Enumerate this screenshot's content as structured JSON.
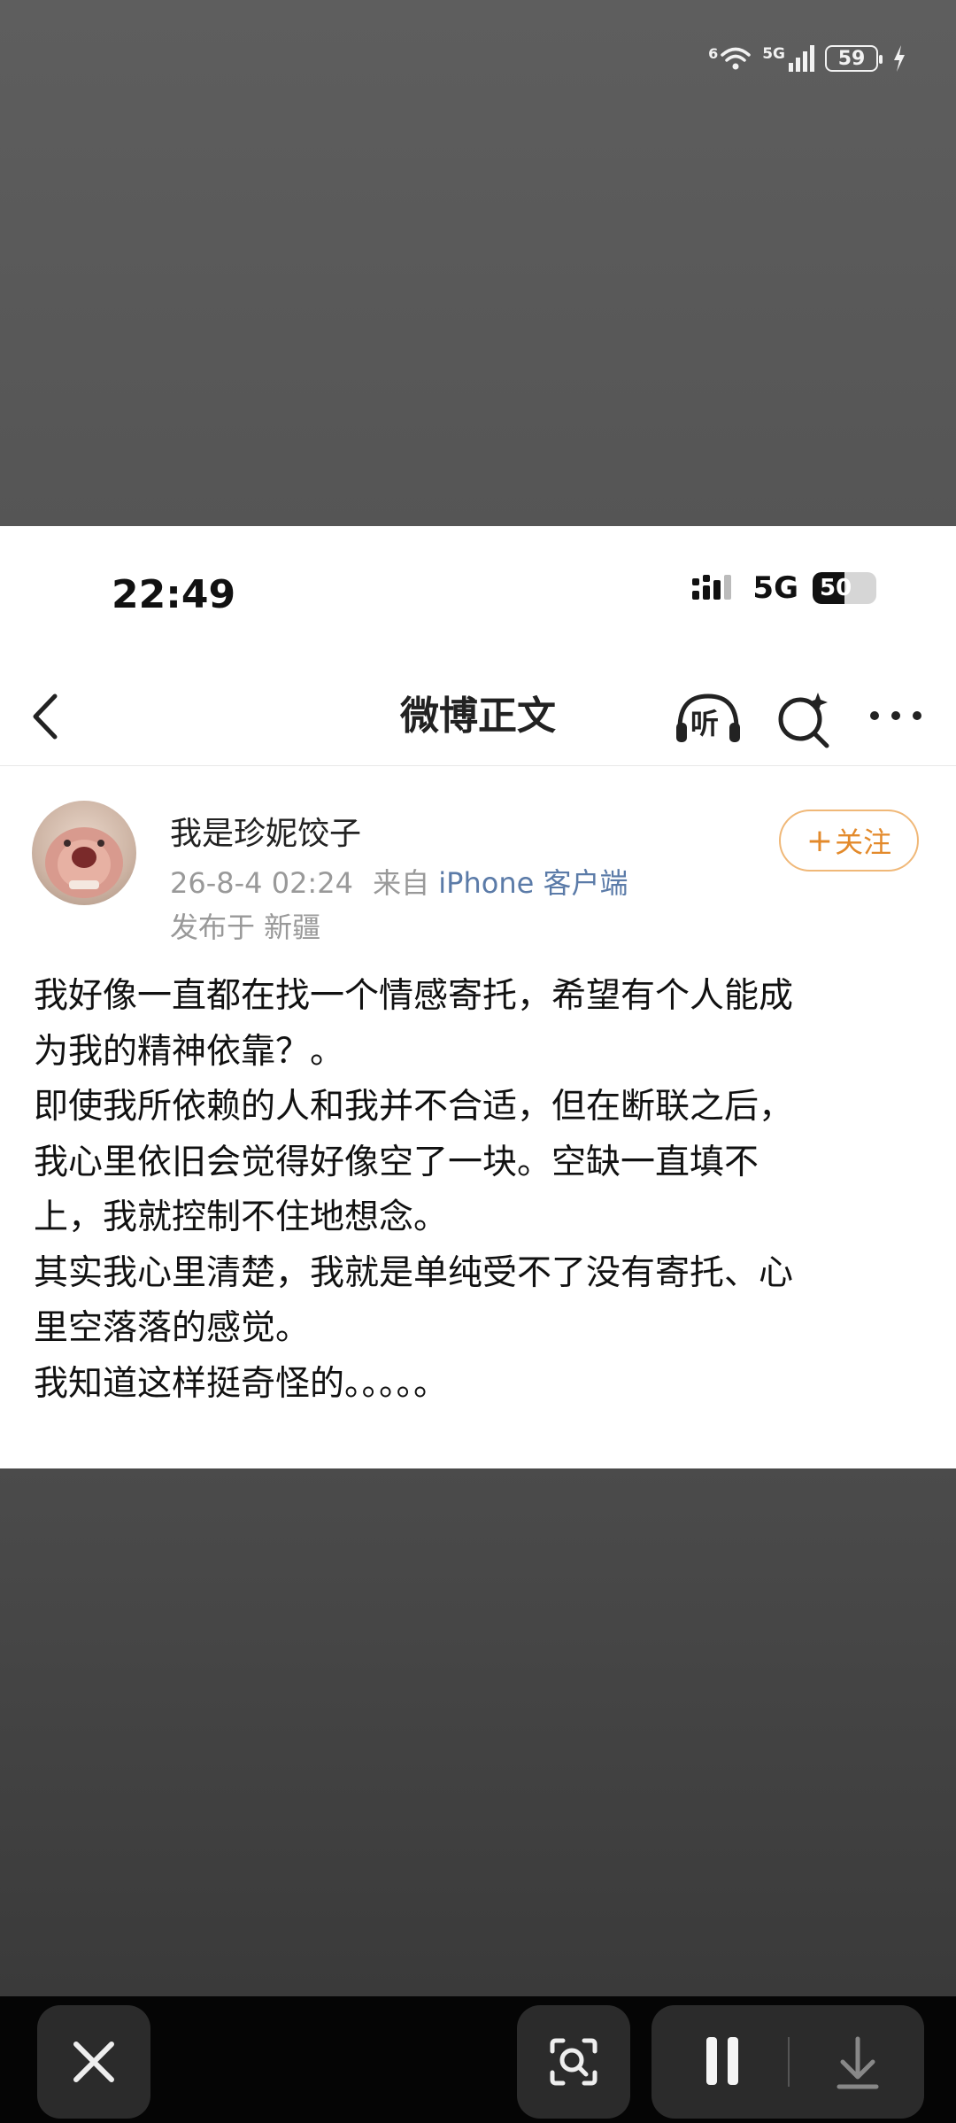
{
  "outer_status": {
    "wifi_badge": "6",
    "network": "5G",
    "battery": "59"
  },
  "post_card": {
    "inner_status": {
      "time": "22:49",
      "network": "5G",
      "battery": "50"
    },
    "nav": {
      "title": "微博正文",
      "listen_label": "听"
    },
    "author": {
      "name": "我是珍妮饺子",
      "timestamp": "26-8-4 02:24",
      "source_prefix": "来自",
      "source": "iPhone 客户端",
      "location": "发布于 新疆"
    },
    "follow_button": {
      "plus": "+",
      "label": "关注"
    },
    "body_lines": [
      "我好像一直都在找一个情感寄托，希望有个人能成",
      "为我的精神依靠？。",
      "即使我所依赖的人和我并不合适，但在断联之后，",
      "我心里依旧会觉得好像空了一块。空缺一直填不",
      "上，我就控制不住地想念。",
      "其实我心里清楚，我就是单纯受不了没有寄托、心",
      "里空落落的感觉。",
      "我知道这样挺奇怪的。。。。。"
    ]
  },
  "icons": {
    "back": "chevron-left-icon",
    "listen": "headphones-icon",
    "search": "search-sparkle-icon",
    "more": "more-dots-icon",
    "close": "close-icon",
    "scan": "scan-search-icon",
    "pause": "pause-icon",
    "download": "download-icon"
  },
  "colors": {
    "follow_accent": "#e38a2b",
    "source_link": "#5b7ba8",
    "backdrop": "#555555",
    "toolbar_button": "#2b2b2b"
  }
}
